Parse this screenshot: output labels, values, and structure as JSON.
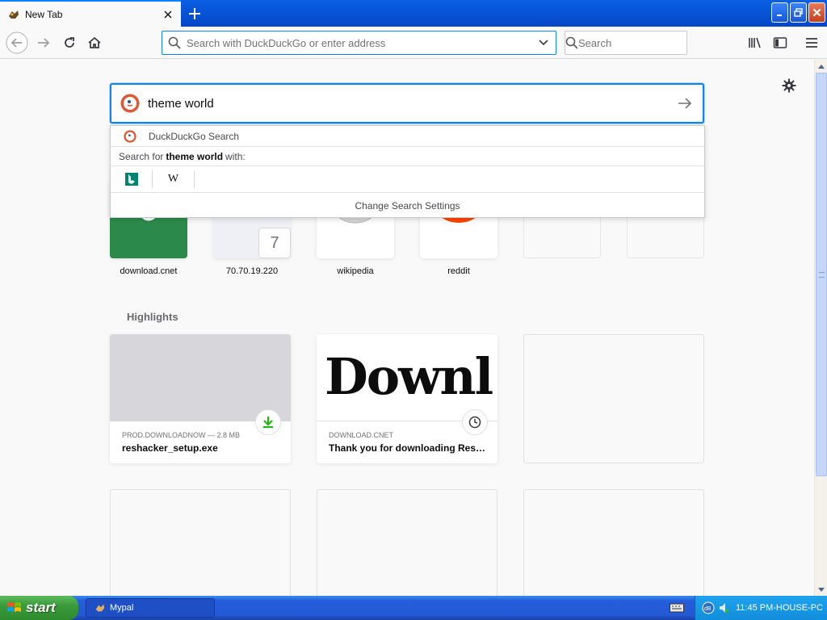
{
  "browser": {
    "tab_title": "New Tab",
    "urlbar_placeholder": "Search with DuckDuckGo or enter address",
    "searchbar_placeholder": "Search"
  },
  "newtab": {
    "search_value": "theme world",
    "dropdown": {
      "engine_row_label": "DuckDuckGo Search",
      "search_for_prefix": "Search for",
      "search_for_query": "theme world",
      "search_for_suffix": "with:",
      "engines": [
        "bing",
        "wikipedia"
      ],
      "settings_label": "Change Search Settings"
    },
    "topsites": [
      {
        "label": "download.cnet",
        "icon": "download-cnet-icon",
        "color": "#2b8a4b"
      },
      {
        "label": "70.70.19.220",
        "icon": "screenshot-thumb",
        "badge": "7"
      },
      {
        "label": "wikipedia",
        "icon": "wikipedia-globe-icon"
      },
      {
        "label": "reddit",
        "icon": "reddit-icon",
        "color": "#ff4500"
      },
      {
        "label": ""
      },
      {
        "label": ""
      }
    ],
    "highlights_title": "Highlights",
    "highlights": [
      {
        "source": "PROD.DOWNLOADNOW — 2.8 MB",
        "title": "reshacker_setup.exe",
        "badge_icon": "download-icon"
      },
      {
        "source": "DOWNLOAD.CNET",
        "title": "Thank you for downloading Reso...",
        "image_text": "Downl",
        "badge_icon": "clock-icon"
      }
    ]
  },
  "taskbar": {
    "start_label": "start",
    "task_label": "Mypal",
    "clock": "11:45 PM-HOUSE-PC"
  }
}
